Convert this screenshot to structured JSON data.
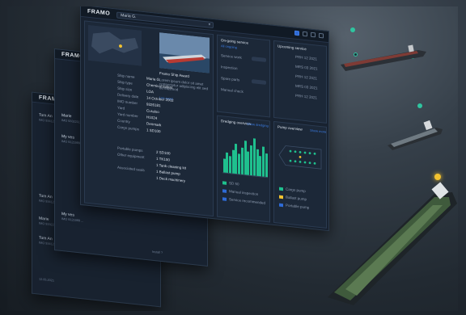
{
  "brand": {
    "logo": "FRAMO",
    "accent": "#2e6bd6",
    "success": "#1fc08e"
  },
  "search": {
    "value": "Maria G.",
    "chevron": "▾"
  },
  "vessel": {
    "fields": [
      {
        "label": "Ship name",
        "value": "Maria G."
      },
      {
        "label": "Ship type",
        "value": "Chemical tanker"
      },
      {
        "label": "Ship size",
        "value": "LOA"
      },
      {
        "label": "Delivery date",
        "value": "14 October 2002"
      },
      {
        "label": "IMO number",
        "value": "9326181"
      },
      {
        "label": "Yard",
        "value": "Curaloo"
      },
      {
        "label": "Yard number",
        "value": "H1024"
      },
      {
        "label": "Country",
        "value": "Denmark"
      },
      {
        "label": "Cargo pumps",
        "value": "1 SD100"
      }
    ],
    "pumps": [
      {
        "label": "Portable pumps",
        "value": "2 SD100"
      },
      {
        "label": "Other equipment",
        "value": "1 TK100"
      },
      {
        "label": "",
        "value": "1 Tank cleaning kit"
      },
      {
        "label": "Associated seals",
        "value": "1 Ballast pump"
      },
      {
        "label": "",
        "value": "1 Deck machinery"
      }
    ],
    "news_title": "Framo Ship Award",
    "news_text": "Lorem ipsum dolor sit amet consectetur adipiscing elit sed do eiusmod",
    "news_link": "Les aussi"
  },
  "on_going": {
    "title": "On-going service",
    "link": "All ongoing",
    "rows": [
      "Service work",
      "Inspection",
      "Spare parts",
      "Manual check"
    ]
  },
  "upcoming": {
    "title": "Upcoming service",
    "rows": [
      "PRH 12 2021",
      "MRS 03 2021",
      "PRH 12 2021",
      "MRS 03 2021",
      "PRH 12 2021"
    ]
  },
  "dredging": {
    "title": "Dredging overview",
    "link": "Show dredging",
    "legend": [
      "SD 50",
      "Manual inspection",
      "Service recommended"
    ]
  },
  "pump_overview": {
    "title": "Pump overview",
    "link": "Show more",
    "legend": [
      "Cargo pump",
      "Ballast pump",
      "Portable pump"
    ]
  },
  "chart_data": {
    "type": "bar",
    "title": "Dredging overview",
    "series": [
      {
        "values": [
          4,
          6,
          5,
          7,
          9,
          6,
          8,
          10,
          7,
          9,
          11,
          8,
          6,
          9,
          7
        ]
      }
    ],
    "categories": [
      "",
      "",
      "",
      "",
      "",
      "",
      "",
      "",
      "",
      "",
      "",
      "",
      "",
      "",
      ""
    ],
    "ylim": [
      0,
      12
    ]
  },
  "back": {
    "logo": "FRAMO",
    "entries": [
      {
        "name": "Tom An",
        "sub": "IMO 9341234 ..."
      },
      {
        "name": "Marie",
        "sub": "IMO 9332211 ..."
      },
      {
        "name": "My ves",
        "sub": "IMO 9121999 ..."
      },
      {
        "name": "Tom An",
        "sub": "IMO 9341234 ..."
      },
      {
        "name": "Marie",
        "sub": "IMO 9332211 ..."
      },
      {
        "name": "My ves",
        "sub": "IMO 9121999 ..."
      },
      {
        "name": "Tom An",
        "sub": "IMO 9341234 ..."
      }
    ],
    "date": "12.05.2021",
    "footer": "Install ?"
  }
}
